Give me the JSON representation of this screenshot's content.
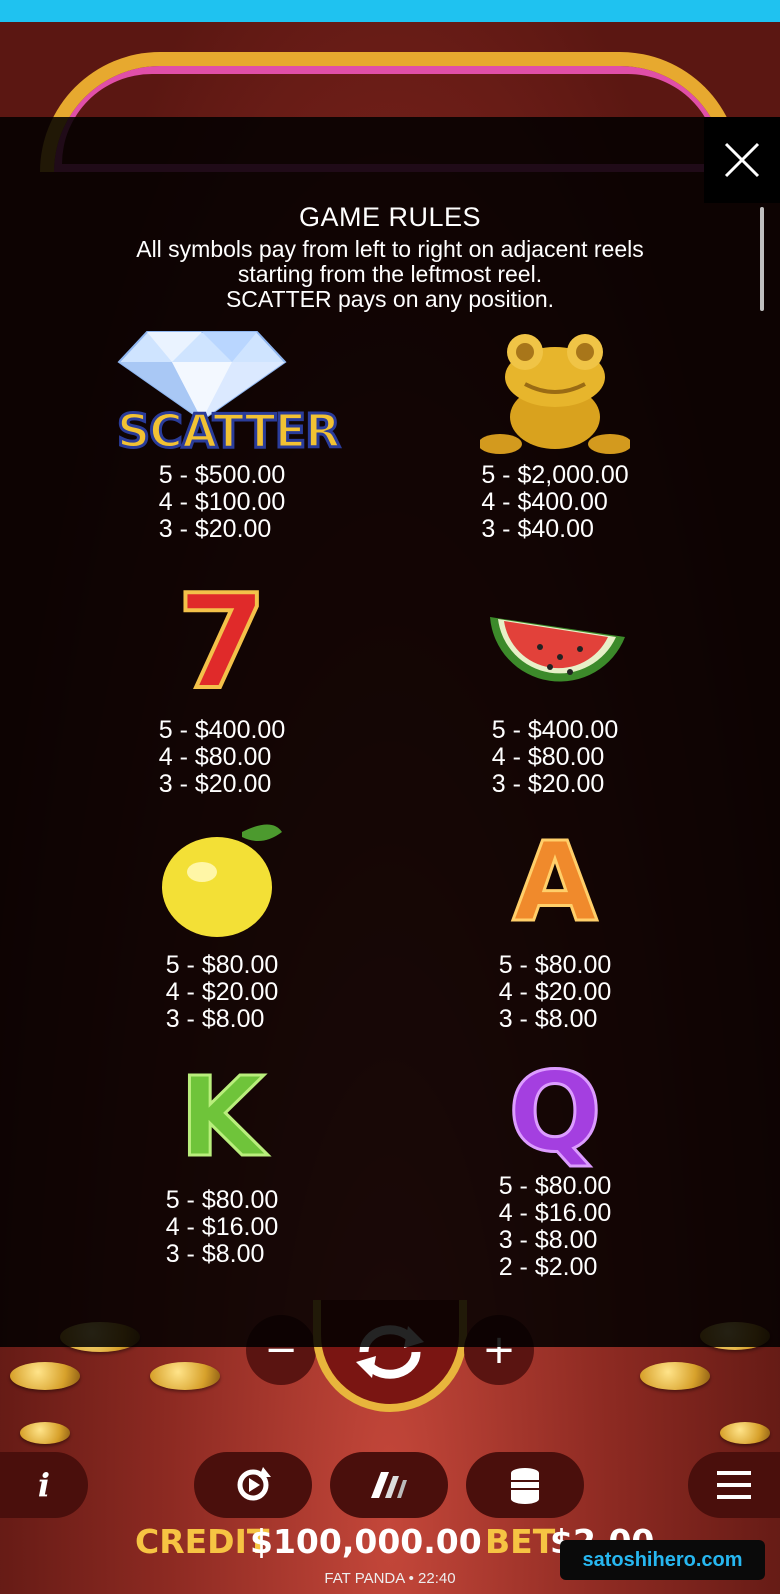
{
  "rules": {
    "title": "GAME RULES",
    "desc_line1": "All symbols pay from left to right on adjacent reels",
    "desc_line2": "starting from the leftmost reel.",
    "desc_line3": "SCATTER pays on any position."
  },
  "symbols": [
    {
      "name": "scatter",
      "icon": "diamond-scatter-icon",
      "label": "SCATTER",
      "pays": [
        "5 - $500.00",
        "4 - $100.00",
        "3 - $20.00"
      ]
    },
    {
      "name": "frog",
      "icon": "golden-frog-icon",
      "pays": [
        "5 - $2,000.00",
        "4 - $400.00",
        "3 - $40.00"
      ]
    },
    {
      "name": "seven",
      "icon": "red-seven-icon",
      "glyph": "7",
      "pays": [
        "5 - $400.00",
        "4 - $80.00",
        "3 - $20.00"
      ]
    },
    {
      "name": "watermelon",
      "icon": "watermelon-icon",
      "pays": [
        "5 - $400.00",
        "4 - $80.00",
        "3 - $20.00"
      ]
    },
    {
      "name": "lemon",
      "icon": "lemon-icon",
      "pays": [
        "5 - $80.00",
        "4 - $20.00",
        "3 - $8.00"
      ]
    },
    {
      "name": "ace",
      "icon": "letter-a-icon",
      "glyph": "A",
      "pays": [
        "5 - $80.00",
        "4 - $20.00",
        "3 - $8.00"
      ]
    },
    {
      "name": "king",
      "icon": "letter-k-icon",
      "glyph": "K",
      "pays": [
        "5 - $80.00",
        "4 - $16.00",
        "3 - $8.00"
      ]
    },
    {
      "name": "queen",
      "icon": "letter-q-icon",
      "glyph": "Q",
      "pays": [
        "5 - $80.00",
        "4 - $16.00",
        "3 - $8.00",
        "2 - $2.00"
      ]
    }
  ],
  "controls": {
    "minus": "−",
    "plus": "+"
  },
  "status": {
    "credit_label": "CREDIT",
    "credit_value": "$100,000.00",
    "bet_label": "BET",
    "bet_value": "$2.00"
  },
  "footer": "FAT PANDA • 22:40",
  "watermark": "satoshihero.com",
  "colors": {
    "accent_gold": "#f6c443",
    "topbar": "#1fc2f0",
    "overlay": "#000000"
  }
}
